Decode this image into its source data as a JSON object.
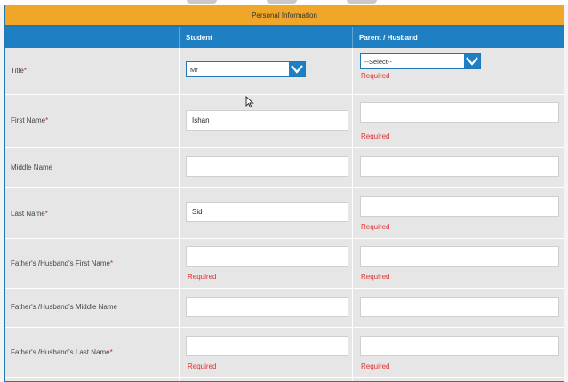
{
  "section_title": "Personal Information",
  "columns": {
    "label_col": "",
    "student": "Student",
    "parent": "Parent / Husband"
  },
  "required_text": "Required",
  "required_star": "*",
  "rows": [
    {
      "label": "Title",
      "required": true,
      "student": {
        "type": "select",
        "value": "Mr"
      },
      "parent": {
        "type": "select",
        "value": "--Select--",
        "error": "Required"
      }
    },
    {
      "label": "First Name",
      "required": true,
      "student": {
        "type": "text",
        "value": "Ishan"
      },
      "parent": {
        "type": "text",
        "value": "",
        "error": "Required"
      }
    },
    {
      "label": "Middle Name",
      "required": false,
      "student": {
        "type": "text",
        "value": ""
      },
      "parent": {
        "type": "text",
        "value": ""
      }
    },
    {
      "label": "Last Name",
      "required": true,
      "student": {
        "type": "text",
        "value": "Sid"
      },
      "parent": {
        "type": "text",
        "value": "",
        "error": "Required"
      }
    },
    {
      "label": "Father's /Husband's First Name",
      "required": true,
      "student": {
        "type": "text",
        "value": "",
        "error": "Required"
      },
      "parent": {
        "type": "text",
        "value": "",
        "error": "Required"
      }
    },
    {
      "label": "Father's /Husband's Middle Name",
      "required": false,
      "student": {
        "type": "text",
        "value": ""
      },
      "parent": {
        "type": "text",
        "value": ""
      }
    },
    {
      "label": "Father's /Husband's Last Name",
      "required": true,
      "student": {
        "type": "text",
        "value": "",
        "error": "Required"
      },
      "parent": {
        "type": "text",
        "value": "",
        "error": "Required"
      }
    }
  ],
  "colors": {
    "header_orange": "#f0a629",
    "header_blue": "#1f7fc3",
    "error_red": "#e03030"
  },
  "icons": {
    "select_chevron": "chevron-down-icon",
    "pointer": "mouse-cursor-icon"
  }
}
